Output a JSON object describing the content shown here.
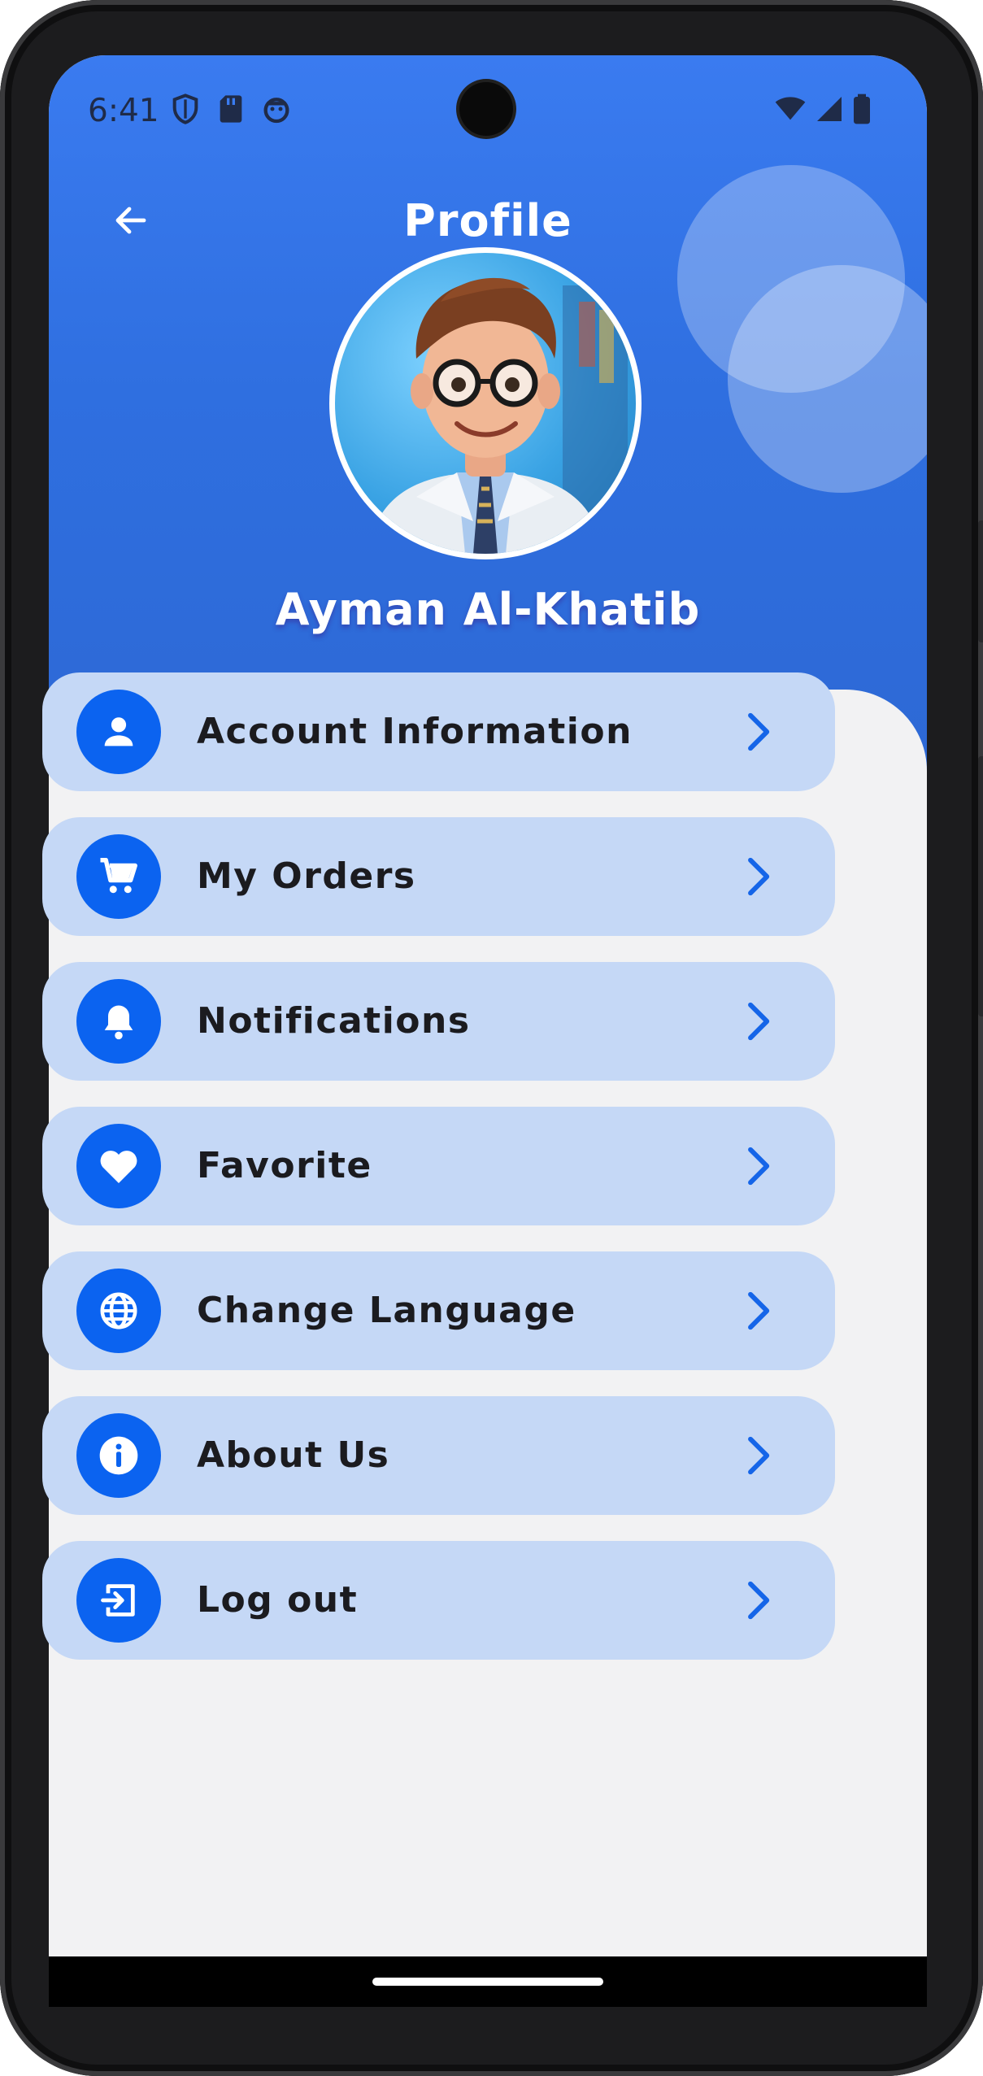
{
  "status_bar": {
    "time": "6:41",
    "left_icons": [
      "shield-icon",
      "sim-card-icon",
      "android-robot-icon"
    ],
    "right_icons": [
      "wifi-icon",
      "cell-signal-icon",
      "battery-icon"
    ]
  },
  "header": {
    "title": "Profile",
    "back_icon": "arrow-left-icon"
  },
  "profile": {
    "name": "Ayman Al-Khatib"
  },
  "menu": {
    "items": [
      {
        "label": "Account Information",
        "icon": "person-icon"
      },
      {
        "label": "My Orders",
        "icon": "cart-icon"
      },
      {
        "label": "Notifications",
        "icon": "bell-icon"
      },
      {
        "label": "Favorite",
        "icon": "heart-icon"
      },
      {
        "label": "Change Language",
        "icon": "globe-icon"
      },
      {
        "label": "About Us",
        "icon": "info-icon"
      },
      {
        "label": "Log out",
        "icon": "logout-icon"
      }
    ]
  },
  "colors": {
    "header_blue": "#3a7bf0",
    "icon_circle": "#0b63f0",
    "item_background": "#c5d8f6",
    "chevron": "#1565e8"
  }
}
